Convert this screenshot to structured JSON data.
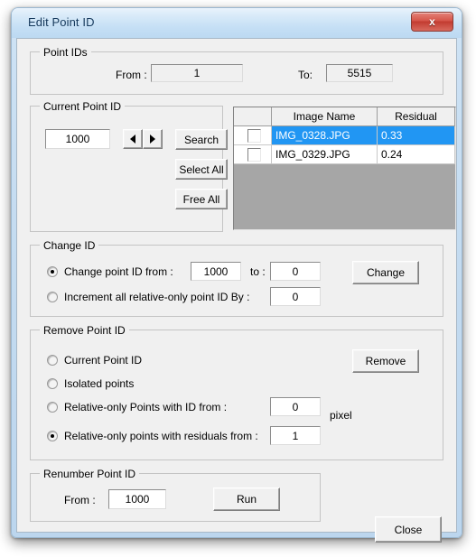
{
  "window": {
    "title": "Edit Point ID",
    "close_label": "x",
    "close_icon": "close-icon"
  },
  "point_ids": {
    "legend": "Point IDs",
    "from_label": "From :",
    "from_value": "1",
    "to_label": "To:",
    "to_value": "5515"
  },
  "current_point_id": {
    "legend": "Current Point ID",
    "value": "1000",
    "prev_icon": "triangle-left-icon",
    "next_icon": "triangle-right-icon",
    "search_label": "Search",
    "select_all_label": "Select All",
    "free_all_label": "Free All"
  },
  "image_grid": {
    "columns": [
      "",
      "Image Name",
      "Residual"
    ],
    "rows": [
      {
        "checked": false,
        "selected": true,
        "image_name": "IMG_0328.JPG",
        "residual": "0.33"
      },
      {
        "checked": false,
        "selected": false,
        "image_name": "IMG_0329.JPG",
        "residual": "0.24"
      }
    ]
  },
  "change_id": {
    "legend": "Change ID",
    "options": [
      {
        "label": "Change point ID from :",
        "selected": true
      },
      {
        "label": "Increment all relative-only point ID By :",
        "selected": false
      }
    ],
    "from_value": "1000",
    "to_label": "to :",
    "to_value": "0",
    "increment_value": "0",
    "change_label": "Change"
  },
  "remove_point_id": {
    "legend": "Remove Point ID",
    "options": [
      {
        "label": "Current Point ID",
        "selected": false
      },
      {
        "label": "Isolated points",
        "selected": false
      },
      {
        "label": "Relative-only Points with ID from :",
        "selected": false
      },
      {
        "label": "Relative-only points with residuals from :",
        "selected": true
      }
    ],
    "id_from_value": "0",
    "pixel_label": "pixel",
    "residual_from_value": "1",
    "remove_label": "Remove"
  },
  "renumber_point_id": {
    "legend": "Renumber Point ID",
    "from_label": "From :",
    "from_value": "1000",
    "run_label": "Run"
  },
  "footer": {
    "close_label": "Close"
  },
  "colors": {
    "titlebar": "#c5dff5",
    "dialog_face": "#f0f0f0",
    "selection": "#2196f3",
    "close_red": "#c23b30"
  }
}
